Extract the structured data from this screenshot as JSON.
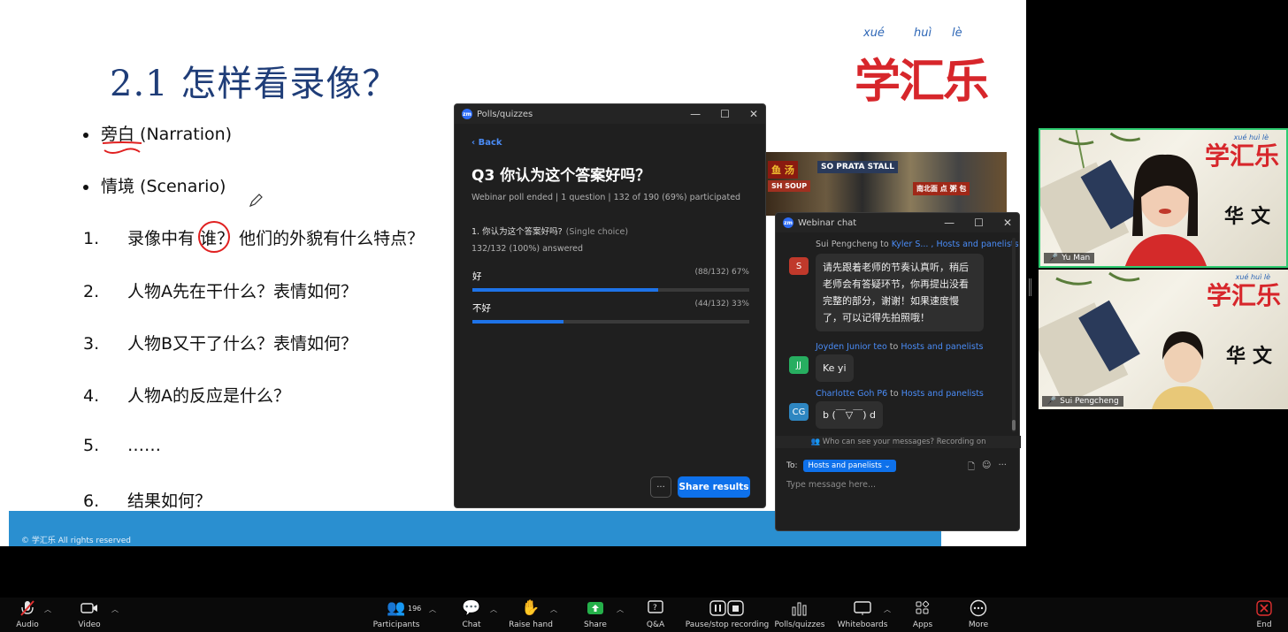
{
  "slide": {
    "title": "2.1 怎样看录像？",
    "logo": {
      "pinyin": [
        "xué",
        "huì",
        "lè"
      ],
      "chars": "学汇乐"
    },
    "bullets": [
      {
        "text": "旁白  (Narration)"
      },
      {
        "text": "情境  (Scenario)"
      }
    ],
    "items": [
      {
        "num": "1.",
        "text": "录像中有 谁？ 他们的外貌有什么特点？"
      },
      {
        "num": "2.",
        "text": "人物A先在干什么？表情如何？"
      },
      {
        "num": "3.",
        "text": "人物B又干了什么？表情如何？"
      },
      {
        "num": "4.",
        "text": "人物A的反应是什么？"
      },
      {
        "num": "5.",
        "text": "……"
      },
      {
        "num": "6.",
        "text": "结果如何？"
      }
    ],
    "footer": "© 学汇乐 All rights reserved",
    "photo_signs": [
      "鱼 汤",
      "SO PRATA STALL",
      "SH SOUP",
      "南北面 点 粥 包"
    ]
  },
  "polls": {
    "window_title": "Polls/quizzes",
    "back": "Back",
    "title": "Q3 你认为这个答案好吗？",
    "meta": "Webinar poll ended  |  1 question  |  132 of 190 (69%) participated",
    "question": "1. 你认为这个答案好吗?",
    "question_type": "(Single choice)",
    "answered": "132/132 (100%) answered",
    "options": [
      {
        "label": "好",
        "stats": "(88/132) 67%",
        "fraction": 0.67
      },
      {
        "label": "不好",
        "stats": "(44/132) 33%",
        "fraction": 0.33
      }
    ],
    "more": "···",
    "share_label": "Share results"
  },
  "chat": {
    "window_title": "Webinar chat",
    "messages": [
      {
        "sender": "Sui Pengcheng",
        "to_word": "to",
        "recipient": "Kyler S... , Hosts and panelists",
        "initials": "S",
        "color": "#c0392b",
        "text": "请先跟着老师的节奏认真听，稍后老师会有答疑环节，你再提出没看完整的部分，谢谢！如果速度慢了，可以记得先拍照哦！"
      },
      {
        "sender": "Joyden Junior teo",
        "to_word": "to",
        "recipient": "Hosts and panelists",
        "initials": "JJ",
        "color": "#27ae60",
        "text": "Ke yi"
      },
      {
        "sender": "Charlotte Goh P6",
        "to_word": "to",
        "recipient": "Hosts and panelists",
        "initials": "CG",
        "color": "#2e86c1",
        "text": "b (￣▽￣) d"
      }
    ],
    "notice": "Who can see your messages? Recording on",
    "to_label": "To:",
    "to_value": "Hosts and panelists",
    "placeholder": "Type message here..."
  },
  "tiles": [
    {
      "name": "Yu Man",
      "logo": "学汇乐",
      "pinyin": "xué  huì  lè",
      "banner": "华文"
    },
    {
      "name": "Sui Pengcheng",
      "logo": "学汇乐",
      "pinyin": "xué  huì  lè",
      "banner": "华文"
    }
  ],
  "toolbar": {
    "participants_count": "196",
    "items": [
      {
        "label": "Audio"
      },
      {
        "label": "Video"
      },
      {
        "label": "Participants"
      },
      {
        "label": "Chat"
      },
      {
        "label": "Raise hand"
      },
      {
        "label": "Share"
      },
      {
        "label": "Q&A"
      },
      {
        "label": "Pause/stop recording"
      },
      {
        "label": "Polls/quizzes"
      },
      {
        "label": "Whiteboards"
      },
      {
        "label": "Apps"
      },
      {
        "label": "More"
      },
      {
        "label": "End"
      }
    ]
  },
  "colors": {
    "accent": "#0e71eb",
    "slide_title": "#1f3d78",
    "logo_red": "#d7262b",
    "footer_blue": "#2a8fd0",
    "active_speaker": "#2ecc71"
  }
}
